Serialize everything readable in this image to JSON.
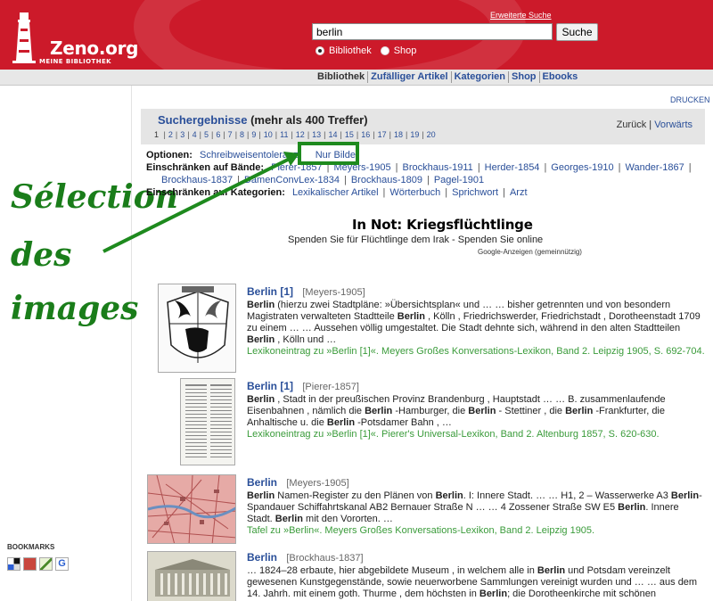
{
  "header": {
    "brand": "Zeno.org",
    "tagline": "MEINE BIBLIOTHEK",
    "advanced_search": "Erweiterte Suche",
    "search_value": "berlin",
    "search_button": "Suche",
    "radio_library": "Bibliothek",
    "radio_shop": "Shop",
    "accent_color": "#cc1a2a"
  },
  "nav": {
    "items": [
      "Bibliothek",
      "Zufälliger Artikel",
      "Kategorien",
      "Shop",
      "Ebooks"
    ]
  },
  "print": "DRUCKEN",
  "results": {
    "title": "Suchergebnisse",
    "count": "(mehr als 400 Treffer)",
    "current_page": "1",
    "pages": [
      "2",
      "3",
      "4",
      "5",
      "6",
      "7",
      "8",
      "9",
      "10",
      "11",
      "12",
      "13",
      "14",
      "15",
      "16",
      "17",
      "18",
      "19",
      "20"
    ],
    "back": "Zurück",
    "forward": "Vorwärts"
  },
  "filters": {
    "options_label": "Optionen:",
    "option_spelling": "Schreibweisentoleranz",
    "option_images": "Nur Bilder",
    "volumes_label": "Einschränken auf Bände:",
    "volumes_row1": [
      "Pierer-1857",
      "Meyers-1905",
      "Brockhaus-1911",
      "Herder-1854",
      "Georges-1910",
      "Wander-1867"
    ],
    "volumes_row2": [
      "Brockhaus-1837",
      "DamenConvLex-1834",
      "Brockhaus-1809",
      "Pagel-1901"
    ],
    "categories_label": "Einschränken auf Kategorien:",
    "categories": [
      "Lexikalischer Artikel",
      "Wörterbuch",
      "Sprichwort",
      "Arzt"
    ]
  },
  "ad": {
    "title": "In Not: Kriegsflüchtlinge",
    "subtitle": "Spenden Sie für Flüchtlinge dem Irak - Spenden Sie online",
    "note": "Google-Anzeigen (gemeinnützig)"
  },
  "annotation": {
    "line1": "Sélection",
    "line2": "des",
    "line3": "images",
    "color": "#1a7d1a"
  },
  "items": [
    {
      "title": "Berlin",
      "num": "[1]",
      "source": "[Meyers-1905]",
      "snippet": [
        {
          "t": "Berlin",
          "b": true
        },
        {
          "t": " (hierzu zwei Stadtpläne: »Übersichtsplan« und … … bisher getrennten und von besondern Magistraten verwalteten Stadtteile "
        },
        {
          "t": "Berlin",
          "b": true
        },
        {
          "t": " , Kölln , Friedrichswerder, Friedrichstadt , Dorotheenstadt 1709 zu einem … … Aussehen völlig umgestaltet. Die Stadt dehnte sich, während in den alten Stadtteilen "
        },
        {
          "t": "Berlin",
          "b": true
        },
        {
          "t": " , Kölln und …"
        }
      ],
      "ref": "Lexikoneintrag zu »Berlin [1]«. Meyers Großes Konversations-Lexikon, Band 2. Leipzig 1905, S. 692-704."
    },
    {
      "title": "Berlin",
      "num": "[1]",
      "source": "[Pierer-1857]",
      "snippet": [
        {
          "t": "Berlin",
          "b": true
        },
        {
          "t": " , Stadt in der preußischen Provinz Brandenburg , Hauptstadt … … B. zusammenlaufende Eisenbahnen , nämlich die "
        },
        {
          "t": "Berlin",
          "b": true
        },
        {
          "t": " -Hamburger, die "
        },
        {
          "t": "Berlin",
          "b": true
        },
        {
          "t": " - Stettiner , die "
        },
        {
          "t": "Berlin",
          "b": true
        },
        {
          "t": " -Frankfurter, die Anhaltische u. die "
        },
        {
          "t": "Berlin",
          "b": true
        },
        {
          "t": " -Potsdamer Bahn , …"
        }
      ],
      "ref": "Lexikoneintrag zu »Berlin [1]«. Pierer's Universal-Lexikon, Band 2. Altenburg 1857, S. 620-630."
    },
    {
      "title": "Berlin",
      "num": "",
      "source": "[Meyers-1905]",
      "snippet": [
        {
          "t": "Berlin",
          "b": true
        },
        {
          "t": " Namen-Register zu den Plänen von "
        },
        {
          "t": "Berlin",
          "b": true
        },
        {
          "t": ". I: Innere Stadt. … … H1, 2 – Wasserwerke A3 "
        },
        {
          "t": "Berlin",
          "b": true
        },
        {
          "t": "-Spandauer Schiffahrtskanal AB2 Bernauer Straße N … … 4 Zossener Straße SW E5 "
        },
        {
          "t": "Berlin",
          "b": true
        },
        {
          "t": ". Innere Stadt. "
        },
        {
          "t": "Berlin",
          "b": true
        },
        {
          "t": " mit den Vororten. …"
        }
      ],
      "ref": "Tafel zu »Berlin«. Meyers Großes Konversations-Lexikon, Band 2. Leipzig 1905."
    },
    {
      "title": "Berlin",
      "num": "",
      "source": "[Brockhaus-1837]",
      "snippet": [
        {
          "t": "… 1824–28 erbaute, hier abgebildete Museum , in welchem alle in "
        },
        {
          "t": "Berlin",
          "b": true
        },
        {
          "t": " und Potsdam vereinzelt gewesenen Kunstgegenstände, sowie neuerworbene Sammlungen vereinigt wurden und … … aus dem 14. Jahrh. mit einem goth. Thurme , dem höchsten in "
        },
        {
          "t": "Berlin",
          "b": true
        },
        {
          "t": "; die Dorotheenkirche mit schönen Grabmälern und"
        }
      ],
      "ref": ""
    }
  ],
  "bookmarks": {
    "label": "BOOKMARKS"
  }
}
